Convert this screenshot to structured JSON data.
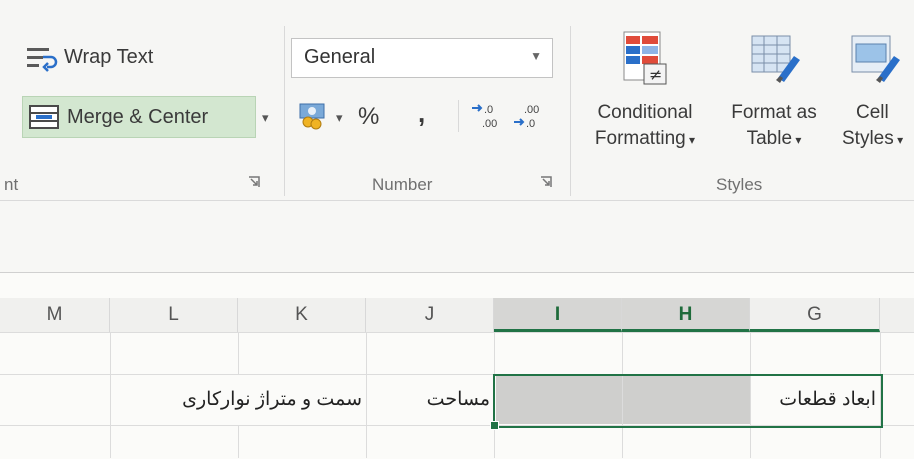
{
  "ribbon": {
    "alignment": {
      "wrap_text_label": "Wrap Text",
      "merge_center_label": "Merge & Center",
      "group_label": "nt"
    },
    "number": {
      "format_value": "General",
      "percent_label": "%",
      "comma_label": ",",
      "group_label": "Number"
    },
    "styles": {
      "conditional_line1": "Conditional",
      "conditional_line2": "Formatting",
      "format_table_line1": "Format as",
      "format_table_line2": "Table",
      "cell_styles_line1": "Cell",
      "cell_styles_line2": "Styles",
      "group_label": "Styles"
    }
  },
  "sheet": {
    "columns": [
      "M",
      "L",
      "K",
      "J",
      "I",
      "H",
      "G"
    ],
    "selected_columns": [
      "I",
      "H"
    ],
    "cells": {
      "g_label": "ابعاد قطعات",
      "j_label": "مساحت",
      "kl_label": "سمت و متراژ نوارکاری"
    }
  },
  "colors": {
    "accent": "#217346",
    "merge_highlight": "#d3e7d0",
    "selection_fill": "#cfcfcd"
  }
}
